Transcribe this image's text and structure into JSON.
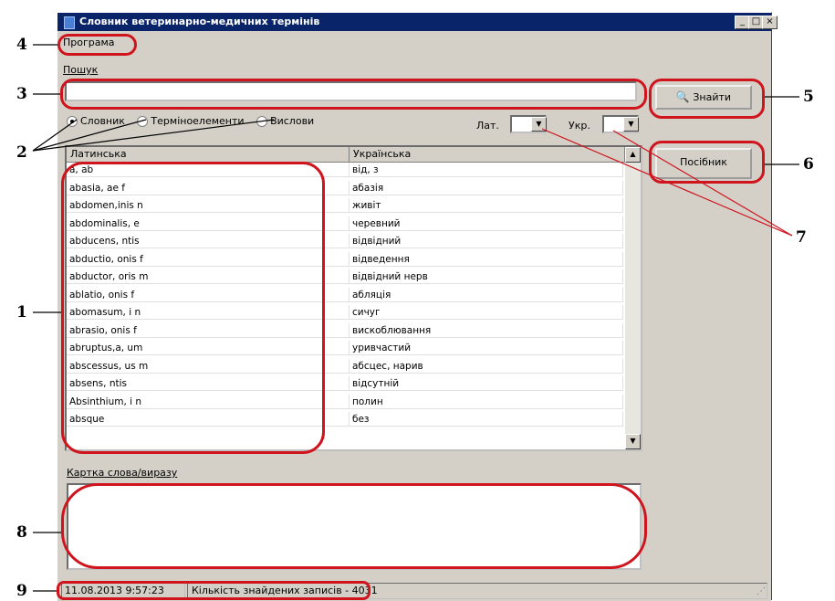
{
  "window": {
    "title": "Словник ветеринарно-медичних термінів",
    "buttons": {
      "minimize": "_",
      "maximize": "□",
      "close": "×"
    }
  },
  "menu": {
    "program": "Програма"
  },
  "search": {
    "label": "Пошук",
    "value": "",
    "find_button": "Знайти"
  },
  "filter": {
    "options": [
      {
        "label": "Словник",
        "selected": true
      },
      {
        "label": "Терміноелементи",
        "selected": false
      },
      {
        "label": "Вислови",
        "selected": false
      }
    ],
    "lat_label": "Лат.",
    "ukr_label": "Укр.",
    "lat_value": "",
    "ukr_value": ""
  },
  "manual_button": "Посібник",
  "table": {
    "columns": [
      "Латинська",
      "Українська"
    ],
    "rows": [
      [
        "a, ab",
        "від, з"
      ],
      [
        "abasia, ae f",
        "абазія"
      ],
      [
        "abdomen,inis n",
        "живіт"
      ],
      [
        "abdominalis, e",
        "черевний"
      ],
      [
        "abducens, ntis",
        "відвідний"
      ],
      [
        "abductio, onis f",
        "відведення"
      ],
      [
        "abductor, oris m",
        "відвідний нерв"
      ],
      [
        "ablatio, onis f",
        "абляція"
      ],
      [
        "abomasum, i n",
        "сичуг"
      ],
      [
        "abrasio, onis f",
        "вискоблювання"
      ],
      [
        "abruptus,a, um",
        "уривчастий"
      ],
      [
        "abscessus, us m",
        "абсцес, нарив"
      ],
      [
        "absens, ntis",
        "відсутній"
      ],
      [
        "Absinthium, i n",
        "полин"
      ],
      [
        "absque",
        "без"
      ]
    ]
  },
  "card": {
    "label": "Картка слова/виразу",
    "text": ""
  },
  "status": {
    "datetime": "11.08.2013  9:57:23",
    "count": "Кількість знайдених записів - 4031"
  },
  "annotations": [
    "1",
    "2",
    "3",
    "4",
    "5",
    "6",
    "7",
    "8",
    "9"
  ],
  "colors": {
    "annotation": "#d0141e",
    "titlebar": "#0a246a",
    "window": "#d4d0c8"
  }
}
